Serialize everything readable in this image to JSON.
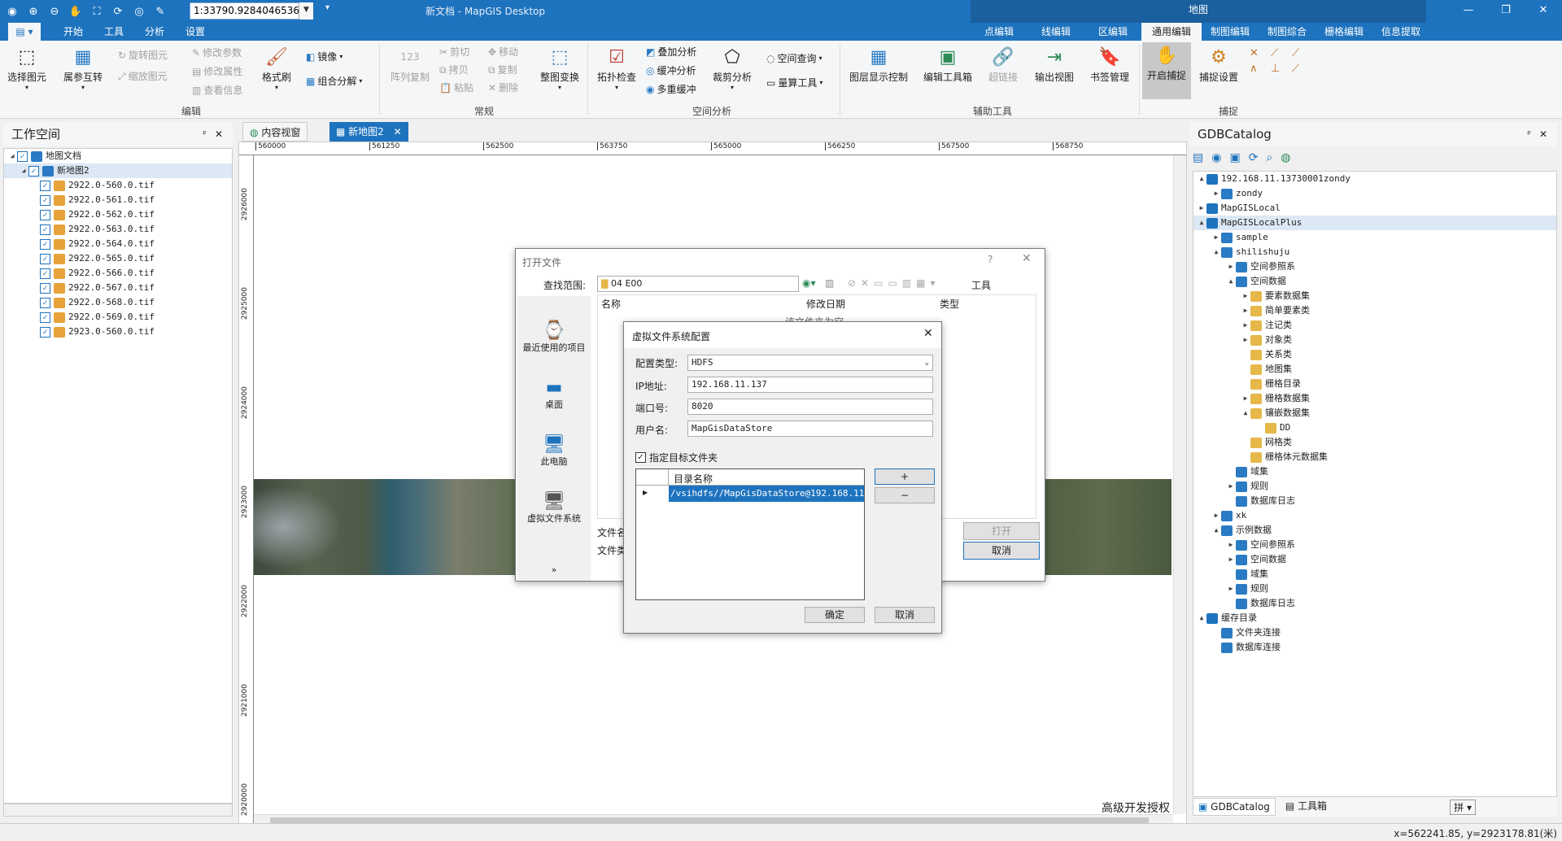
{
  "title_bar": {
    "app_title": "新文档 - MapGIS Desktop",
    "context_title": "地图",
    "scale": "1:33790.9284046536"
  },
  "menu": {
    "tabs": [
      "开始",
      "工具",
      "分析",
      "设置"
    ],
    "context_tabs": [
      "点编辑",
      "线编辑",
      "区编辑",
      "通用编辑",
      "制图编辑",
      "制图综合",
      "栅格编辑",
      "信息提取"
    ],
    "active": "通用编辑"
  },
  "ribbon": {
    "edit": {
      "name": "编辑",
      "select": "选择图元",
      "attr_swap": "属参互转",
      "rotate": "旋转图元",
      "zoom": "缩放图元",
      "modify_param": "修改参数",
      "modify_attr": "修改属性",
      "view_info": "查看信息",
      "format_brush": "格式刷",
      "mirror": "镜像",
      "combine": "组合分解"
    },
    "common": {
      "name": "常规",
      "array_copy": "阵列复制",
      "cut": "剪切",
      "copy_paste": "拷贝",
      "paste": "粘贴",
      "move": "移动",
      "copy": "复制",
      "delete": "删除",
      "transform": "整图变换"
    },
    "spatial": {
      "name": "空间分析",
      "topo": "拓扑检查",
      "overlay": "叠加分析",
      "buffer": "缓冲分析",
      "multi_buffer": "多重缓冲",
      "clip": "裁剪分析",
      "query": "空间查询",
      "measure": "量算工具"
    },
    "aux": {
      "name": "辅助工具",
      "layer_ctrl": "图层显示控制",
      "edit_toolbox": "编辑工具箱",
      "hyperlink": "超链接",
      "export_view": "输出视图",
      "bookmark": "书签管理"
    },
    "snap": {
      "name": "捕捉",
      "enable": "开启捕捉",
      "settings": "捕捉设置"
    }
  },
  "workspace": {
    "title": "工作空间",
    "root": "地图文档",
    "map": "新地图2",
    "files": [
      "2922.0-560.0.tif",
      "2922.0-561.0.tif",
      "2922.0-562.0.tif",
      "2922.0-563.0.tif",
      "2922.0-564.0.tif",
      "2922.0-565.0.tif",
      "2922.0-566.0.tif",
      "2922.0-567.0.tif",
      "2922.0-568.0.tif",
      "2922.0-569.0.tif",
      "2923.0-560.0.tif"
    ]
  },
  "doc_tabs": [
    "内容视窗",
    "新地图2"
  ],
  "map": {
    "x_ticks": [
      "560000",
      "561250",
      "562500",
      "563750",
      "565000",
      "566250",
      "567500",
      "568750"
    ],
    "y_ticks": [
      "2926000",
      "2925000",
      "2924000",
      "2923000",
      "2922000",
      "2921000",
      "2920000"
    ],
    "watermark": "高级开发授权"
  },
  "open_dialog": {
    "title": "打开文件",
    "lookin_label": "查找范围:",
    "lookin_value": "04 E00",
    "tools": "工具",
    "col_name": "名称",
    "col_date": "修改日期",
    "col_type": "类型",
    "empty": "该文件夹为空",
    "places": [
      "最近使用的项目",
      "桌面",
      "此电脑",
      "虚拟文件系统"
    ],
    "more": "»",
    "filename_label": "文件名",
    "filetype_label": "文件类",
    "open_btn": "打开",
    "cancel_btn": "取消"
  },
  "vfs_dialog": {
    "title": "虚拟文件系统配置",
    "type_label": "配置类型:",
    "type_value": "HDFS",
    "ip_label": "IP地址:",
    "ip_value": "192.168.11.137",
    "port_label": "端口号:",
    "port_value": "8020",
    "user_label": "用户名:",
    "user_value": "MapGisDataStore",
    "target_label": "指定目标文件夹",
    "dir_header": "目录名称",
    "dir_row": "/vsihdfs//MapGisDataStore@192.168.11...",
    "add": "+",
    "remove": "−",
    "ok": "确定",
    "cancel": "取消"
  },
  "gdb": {
    "title": "GDBCatalog",
    "nodes": [
      {
        "t": "192.168.11.13730001zondy",
        "d": 0,
        "e": "▲"
      },
      {
        "t": "zondy",
        "d": 1,
        "e": "▶"
      },
      {
        "t": "MapGISLocal",
        "d": 0,
        "e": "▶"
      },
      {
        "t": "MapGISLocalPlus",
        "d": 0,
        "e": "▲",
        "sel": true
      },
      {
        "t": "sample",
        "d": 1,
        "e": "▶"
      },
      {
        "t": "shilishuju",
        "d": 1,
        "e": "▲"
      },
      {
        "t": "空间参照系",
        "d": 2,
        "e": "▶"
      },
      {
        "t": "空间数据",
        "d": 2,
        "e": "▲"
      },
      {
        "t": "要素数据集",
        "d": 3,
        "e": "▶"
      },
      {
        "t": "简单要素类",
        "d": 3,
        "e": "▶"
      },
      {
        "t": "注记类",
        "d": 3,
        "e": "▶"
      },
      {
        "t": "对象类",
        "d": 3,
        "e": "▶"
      },
      {
        "t": "关系类",
        "d": 3,
        "e": ""
      },
      {
        "t": "地图集",
        "d": 3,
        "e": ""
      },
      {
        "t": "栅格目录",
        "d": 3,
        "e": ""
      },
      {
        "t": "栅格数据集",
        "d": 3,
        "e": "▶"
      },
      {
        "t": "镶嵌数据集",
        "d": 3,
        "e": "▲"
      },
      {
        "t": "DD",
        "d": 4,
        "e": ""
      },
      {
        "t": "网格类",
        "d": 3,
        "e": ""
      },
      {
        "t": "栅格体元数据集",
        "d": 3,
        "e": ""
      },
      {
        "t": "域集",
        "d": 2,
        "e": ""
      },
      {
        "t": "规则",
        "d": 2,
        "e": "▶"
      },
      {
        "t": "数据库日志",
        "d": 2,
        "e": ""
      },
      {
        "t": "xk",
        "d": 1,
        "e": "▶"
      },
      {
        "t": "示例数据",
        "d": 1,
        "e": "▲"
      },
      {
        "t": "空间参照系",
        "d": 2,
        "e": "▶"
      },
      {
        "t": "空间数据",
        "d": 2,
        "e": "▶"
      },
      {
        "t": "域集",
        "d": 2,
        "e": ""
      },
      {
        "t": "规则",
        "d": 2,
        "e": "▶"
      },
      {
        "t": "数据库日志",
        "d": 2,
        "e": ""
      },
      {
        "t": "缓存目录",
        "d": 0,
        "e": "▲"
      },
      {
        "t": "文件夹连接",
        "d": 1,
        "e": ""
      },
      {
        "t": "数据库连接",
        "d": 1,
        "e": ""
      }
    ],
    "tab1": "GDBCatalog",
    "tab2": "工具箱"
  },
  "status": {
    "coords": "x=562241.85, y=2923178.81(米)"
  }
}
